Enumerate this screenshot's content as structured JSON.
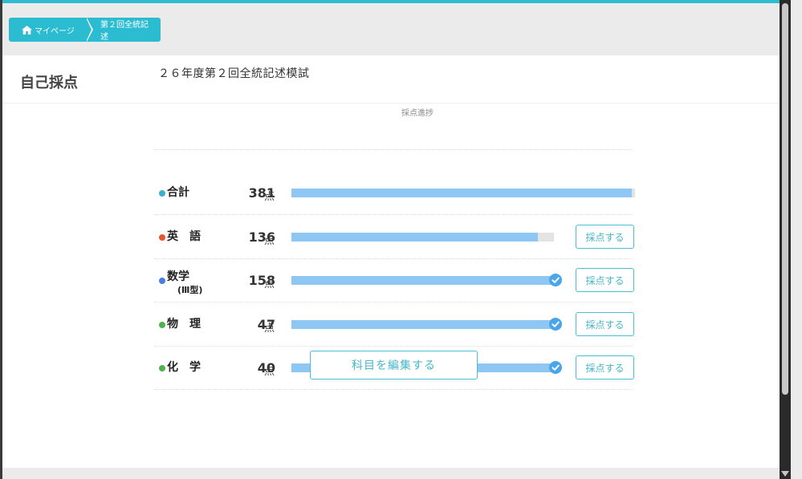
{
  "breadcrumb": {
    "home_label": "マイページ",
    "current_label": "第２回全統記述"
  },
  "card": {
    "title": "自己採点"
  },
  "exam": {
    "title": "２６年度第２回全統記述模試",
    "progress_header": "採点進捗"
  },
  "rows": [
    {
      "name": "合計",
      "sub": "",
      "score": "381",
      "unit": "点",
      "progress": 0.99,
      "complete": false,
      "button": "",
      "dot_color": "#3aaecb"
    },
    {
      "name": "英　語",
      "sub": "",
      "score": "136",
      "unit": "点",
      "progress": 0.94,
      "complete": false,
      "button": "採点する",
      "dot_color": "#e0582c"
    },
    {
      "name": "数学",
      "sub": "(Ⅲ型)",
      "score": "158",
      "unit": "点",
      "progress": 1.0,
      "complete": true,
      "button": "採点する",
      "dot_color": "#4a7de0"
    },
    {
      "name": "物　理",
      "sub": "",
      "score": "47",
      "unit": "点",
      "progress": 1.0,
      "complete": true,
      "button": "採点する",
      "dot_color": "#4db34a"
    },
    {
      "name": "化　学",
      "sub": "",
      "score": "40",
      "unit": "点",
      "progress": 1.0,
      "complete": true,
      "button": "採点する",
      "dot_color": "#4db34a"
    }
  ],
  "actions": {
    "edit_label": "科目を編集する"
  },
  "icons": {
    "home": "home-icon",
    "check": "check-circle-icon"
  }
}
